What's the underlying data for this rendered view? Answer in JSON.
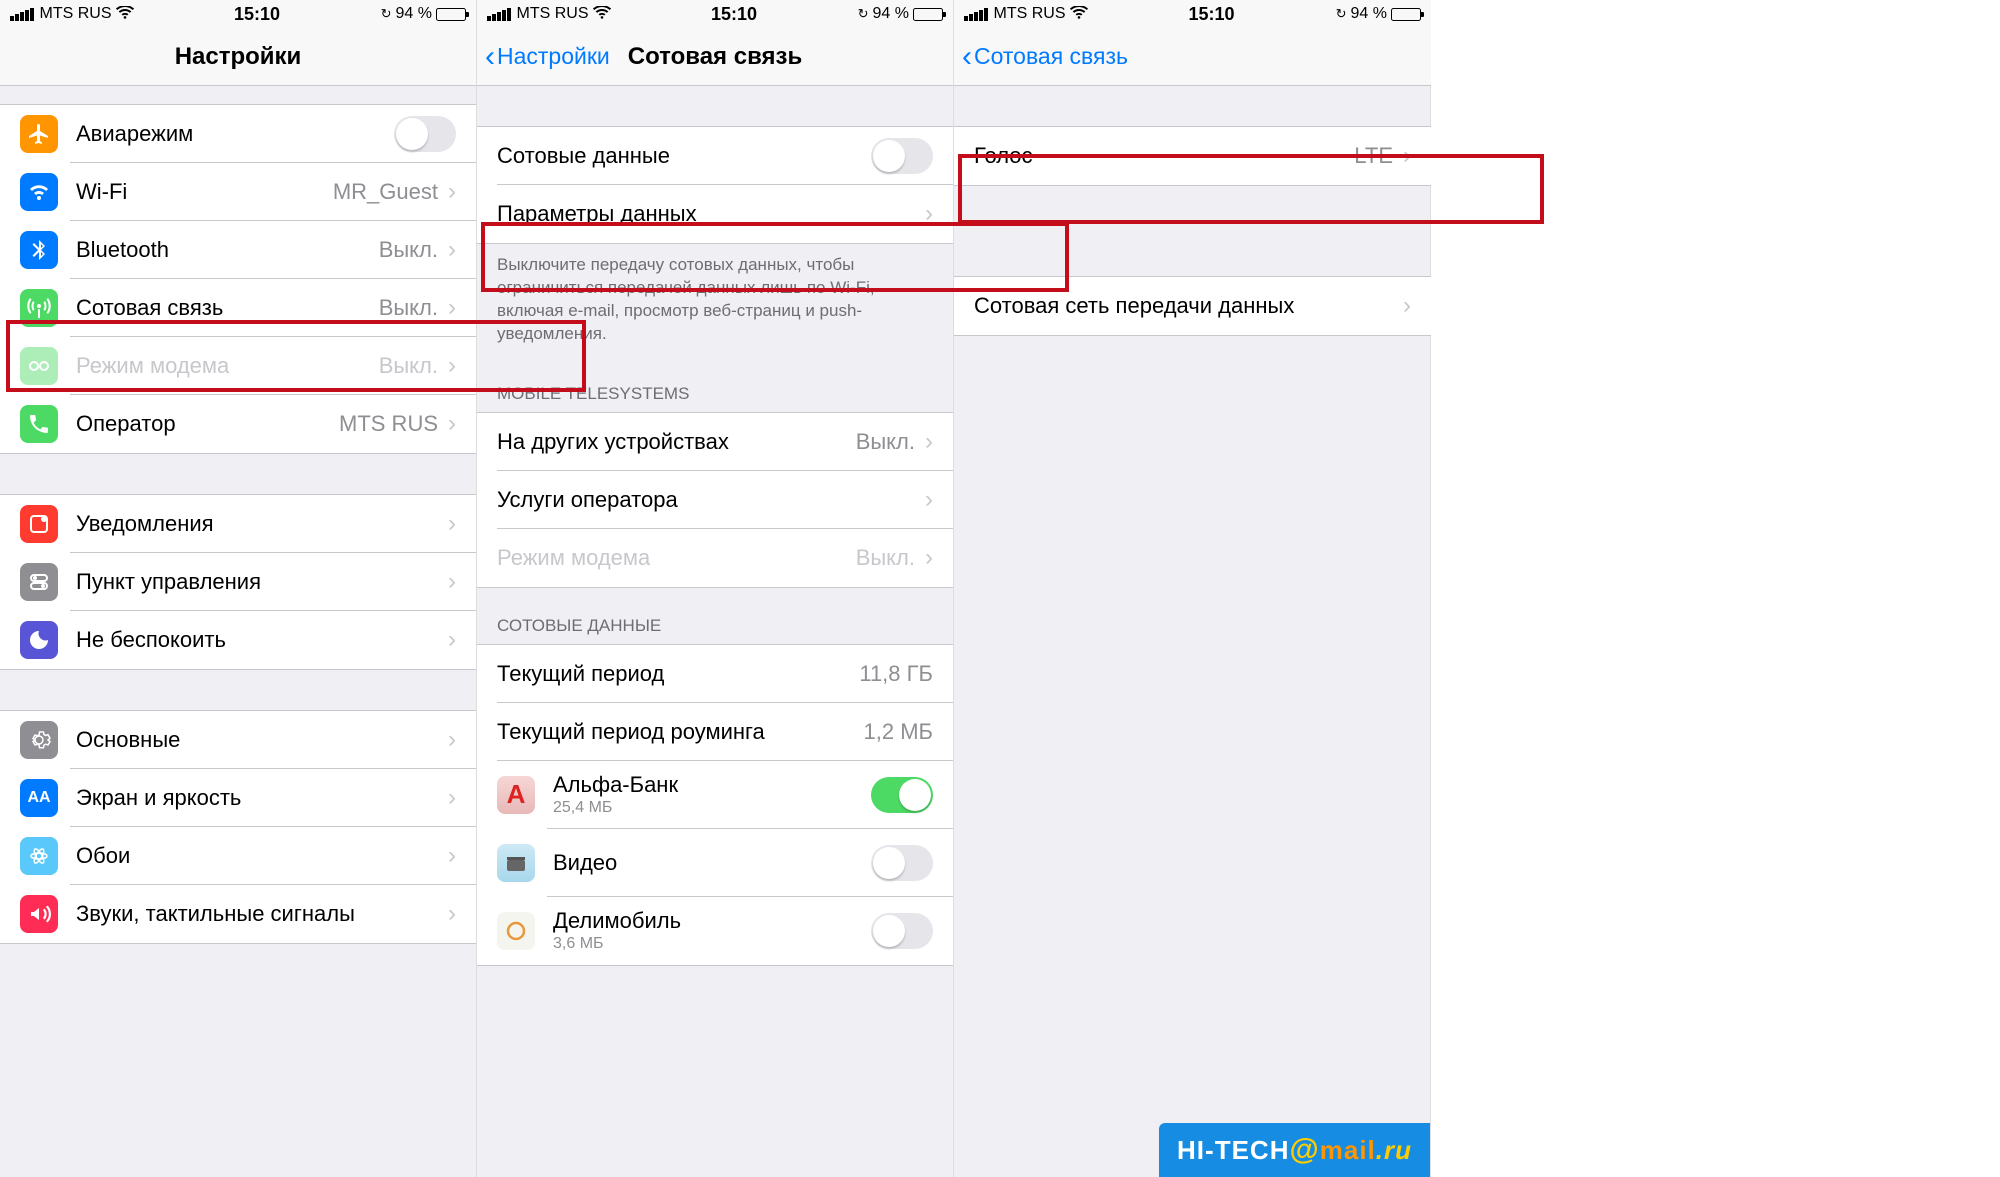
{
  "status": {
    "carrier": "MTS RUS",
    "time": "15:10",
    "battery_pct": "94 %"
  },
  "screen1": {
    "title": "Настройки",
    "rows": {
      "airplane": "Авиарежим",
      "wifi": "Wi-Fi",
      "wifi_value": "MR_Guest",
      "bluetooth": "Bluetooth",
      "bluetooth_value": "Выкл.",
      "cellular": "Сотовая связь",
      "cellular_value": "Выкл.",
      "hotspot": "Режим модема",
      "hotspot_value": "Выкл.",
      "operator": "Оператор",
      "operator_value": "MTS RUS",
      "notifications": "Уведомления",
      "control_center": "Пункт управления",
      "dnd": "Не беспокоить",
      "general": "Основные",
      "display": "Экран и яркость",
      "wallpaper": "Обои",
      "sounds": "Звуки, тактильные сигналы"
    }
  },
  "screen2": {
    "back": "Настройки",
    "title": "Сотовая связь",
    "cellular_data": "Сотовые данные",
    "data_options": "Параметры данных",
    "footer1": "Выключите передачу сотовых данных, чтобы ограничиться передачей данных лишь по Wi-Fi, включая e-mail, просмотр веб-страниц и push-уведомления.",
    "section_operator": "MOBILE TELESYSTEMS",
    "other_devices": "На других устройствах",
    "other_devices_value": "Выкл.",
    "carrier_services": "Услуги оператора",
    "hotspot": "Режим модема",
    "hotspot_value": "Выкл.",
    "section_data": "СОТОВЫЕ ДАННЫЕ",
    "current_period": "Текущий период",
    "current_period_value": "11,8 ГБ",
    "roaming_period": "Текущий период роуминга",
    "roaming_period_value": "1,2 МБ",
    "app1": "Альфа-Банк",
    "app1_size": "25,4 МБ",
    "app2": "Видео",
    "app3": "Делимобиль",
    "app3_size": "3,6 МБ"
  },
  "screen3": {
    "back": "Сотовая связь",
    "voice": "Голос",
    "voice_value": "LTE",
    "data_network": "Сотовая сеть передачи данных"
  },
  "watermark": {
    "t1": "HI-TECH",
    "t2": "mail",
    "t3": ".ru"
  }
}
